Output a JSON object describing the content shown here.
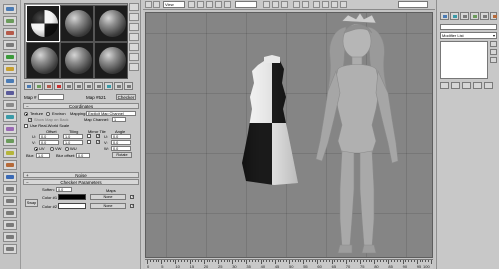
{
  "material_editor": {
    "slots": [
      {
        "type": "checker",
        "active": true
      },
      {
        "type": "plain"
      },
      {
        "type": "plain"
      },
      {
        "type": "plain"
      },
      {
        "type": "plain"
      },
      {
        "type": "plain"
      }
    ],
    "name_label": "Map #",
    "name_value": "",
    "map_name": "Map #521",
    "type_button": "Checker",
    "coordinates_title": "Coordinates",
    "noise_title": "Noise",
    "checker_title": "Checker Parameters",
    "coords": {
      "texture_label": "Texture",
      "environ_label": "Environ",
      "mapping_label": "Mapping:",
      "mapping_value": "Explicit Map Channel",
      "show_map_label": "Show Map on Back",
      "map_channel_label": "Map Channel:",
      "map_channel_value": "1",
      "use_real_world_label": "Use Real-World Scale",
      "offset_label": "Offset",
      "tiling_label": "Tiling",
      "mirror_tile_label": "Mirror Tile",
      "angle_label": "Angle",
      "u_label": "U:",
      "v_label": "V:",
      "w_label": "W:",
      "u_offset": "0.0",
      "v_offset": "0.0",
      "u_tiling": "1.0",
      "v_tiling": "1.0",
      "u_angle": "0.0",
      "v_angle": "0.0",
      "w_angle": "0.0",
      "uv_label": "UV",
      "vw_label": "VW",
      "wu_label": "WU",
      "blur_label": "Blur:",
      "blur_value": "1.0",
      "blur_offset_label": "Blur offset:",
      "blur_offset_value": "0.0",
      "rotate_button": "Rotate"
    },
    "checker": {
      "soften_label": "Soften:",
      "soften_value": "0.0",
      "maps_label": "Maps",
      "swap_button": "Swap",
      "color1_label": "Color #1",
      "color2_label": "Color #2",
      "color1": "#000000",
      "color2": "#ffffff",
      "map1": "None",
      "map2": "None"
    }
  },
  "viewport": {
    "top_dropdown": "View",
    "ruler_ticks": [
      "0",
      "5",
      "10",
      "15",
      "20",
      "25",
      "30",
      "35",
      "40",
      "45",
      "50",
      "55",
      "60",
      "65",
      "70",
      "75",
      "80",
      "85",
      "90",
      "95",
      "100"
    ]
  },
  "command_panel": {
    "modifier_list": "Modifier List"
  }
}
